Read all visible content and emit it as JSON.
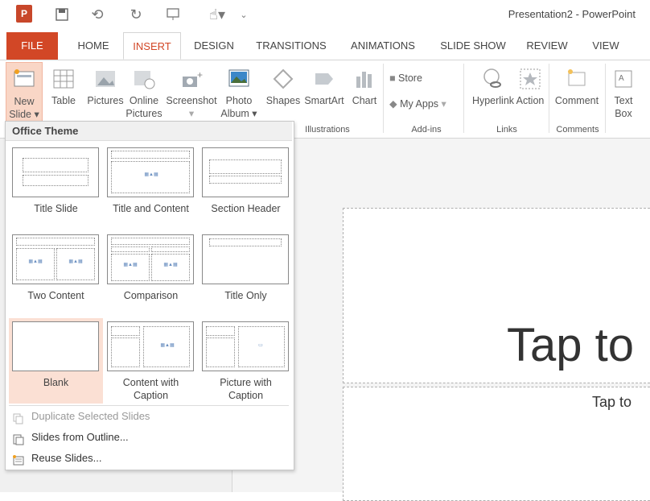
{
  "app": {
    "title": "Presentation2 - PowerPoint",
    "logo": "P"
  },
  "tabs": [
    "FILE",
    "HOME",
    "INSERT",
    "DESIGN",
    "TRANSITIONS",
    "ANIMATIONS",
    "SLIDE SHOW",
    "REVIEW",
    "VIEW"
  ],
  "active_tab": "INSERT",
  "ribbon": {
    "new_slide": [
      "New",
      "Slide ▾"
    ],
    "table": "Table",
    "pictures": "Pictures",
    "online_pictures": [
      "Online",
      "Pictures"
    ],
    "screenshot": "Screenshot",
    "photo_album": [
      "Photo",
      "Album ▾"
    ],
    "shapes": "Shapes",
    "smartart": "SmartArt",
    "chart": "Chart",
    "store": "Store",
    "my_apps": "My Apps",
    "hyperlink": "Hyperlink",
    "action": "Action",
    "comment": "Comment",
    "text_box": [
      "Text",
      "Box"
    ],
    "groups": {
      "illustrations": "Illustrations",
      "addins": "Add-ins",
      "links": "Links",
      "comments": "Comments"
    }
  },
  "gallery": {
    "header": "Office Theme",
    "layouts": [
      {
        "label": [
          "Title Slide"
        ]
      },
      {
        "label": [
          "Title and Content"
        ]
      },
      {
        "label": [
          "Section Header"
        ]
      },
      {
        "label": [
          "Two Content"
        ]
      },
      {
        "label": [
          "Comparison"
        ]
      },
      {
        "label": [
          "Title Only"
        ]
      },
      {
        "label": [
          "Blank"
        ]
      },
      {
        "label": [
          "Content with",
          "Caption"
        ]
      },
      {
        "label": [
          "Picture with",
          "Caption"
        ]
      }
    ],
    "menu": [
      {
        "label": "Duplicate Selected Slides",
        "disabled": true
      },
      {
        "label": "Slides from Outline...",
        "disabled": false
      },
      {
        "label": "Reuse Slides...",
        "disabled": false
      }
    ]
  },
  "slide": {
    "title_placeholder": "Tap to",
    "subtitle_placeholder": "Tap to"
  },
  "colors": {
    "accent": "#d24726",
    "selected_bg": "#fbe0d4"
  }
}
